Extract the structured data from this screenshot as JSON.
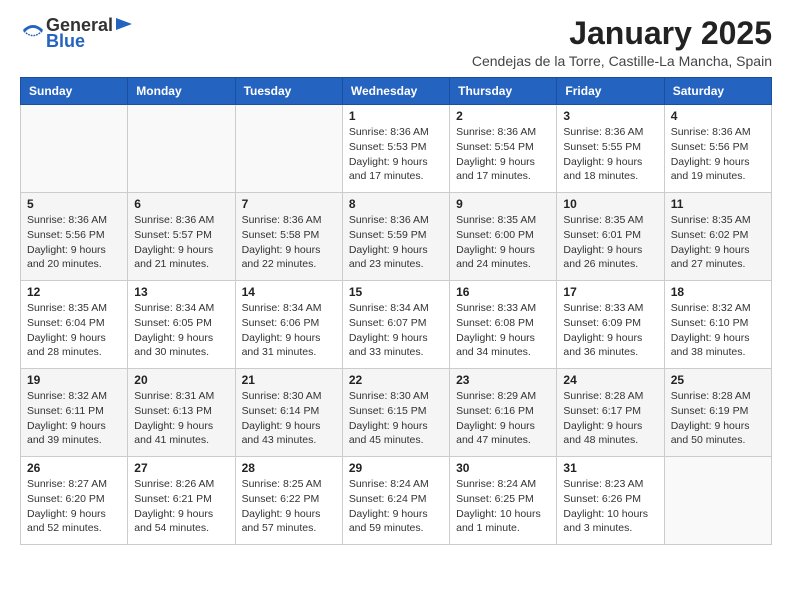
{
  "header": {
    "logo_general": "General",
    "logo_blue": "Blue",
    "month": "January 2025",
    "location": "Cendejas de la Torre, Castille-La Mancha, Spain"
  },
  "weekdays": [
    "Sunday",
    "Monday",
    "Tuesday",
    "Wednesday",
    "Thursday",
    "Friday",
    "Saturday"
  ],
  "weeks": [
    [
      {
        "day": "",
        "info": ""
      },
      {
        "day": "",
        "info": ""
      },
      {
        "day": "",
        "info": ""
      },
      {
        "day": "1",
        "info": "Sunrise: 8:36 AM\nSunset: 5:53 PM\nDaylight: 9 hours\nand 17 minutes."
      },
      {
        "day": "2",
        "info": "Sunrise: 8:36 AM\nSunset: 5:54 PM\nDaylight: 9 hours\nand 17 minutes."
      },
      {
        "day": "3",
        "info": "Sunrise: 8:36 AM\nSunset: 5:55 PM\nDaylight: 9 hours\nand 18 minutes."
      },
      {
        "day": "4",
        "info": "Sunrise: 8:36 AM\nSunset: 5:56 PM\nDaylight: 9 hours\nand 19 minutes."
      }
    ],
    [
      {
        "day": "5",
        "info": "Sunrise: 8:36 AM\nSunset: 5:56 PM\nDaylight: 9 hours\nand 20 minutes."
      },
      {
        "day": "6",
        "info": "Sunrise: 8:36 AM\nSunset: 5:57 PM\nDaylight: 9 hours\nand 21 minutes."
      },
      {
        "day": "7",
        "info": "Sunrise: 8:36 AM\nSunset: 5:58 PM\nDaylight: 9 hours\nand 22 minutes."
      },
      {
        "day": "8",
        "info": "Sunrise: 8:36 AM\nSunset: 5:59 PM\nDaylight: 9 hours\nand 23 minutes."
      },
      {
        "day": "9",
        "info": "Sunrise: 8:35 AM\nSunset: 6:00 PM\nDaylight: 9 hours\nand 24 minutes."
      },
      {
        "day": "10",
        "info": "Sunrise: 8:35 AM\nSunset: 6:01 PM\nDaylight: 9 hours\nand 26 minutes."
      },
      {
        "day": "11",
        "info": "Sunrise: 8:35 AM\nSunset: 6:02 PM\nDaylight: 9 hours\nand 27 minutes."
      }
    ],
    [
      {
        "day": "12",
        "info": "Sunrise: 8:35 AM\nSunset: 6:04 PM\nDaylight: 9 hours\nand 28 minutes."
      },
      {
        "day": "13",
        "info": "Sunrise: 8:34 AM\nSunset: 6:05 PM\nDaylight: 9 hours\nand 30 minutes."
      },
      {
        "day": "14",
        "info": "Sunrise: 8:34 AM\nSunset: 6:06 PM\nDaylight: 9 hours\nand 31 minutes."
      },
      {
        "day": "15",
        "info": "Sunrise: 8:34 AM\nSunset: 6:07 PM\nDaylight: 9 hours\nand 33 minutes."
      },
      {
        "day": "16",
        "info": "Sunrise: 8:33 AM\nSunset: 6:08 PM\nDaylight: 9 hours\nand 34 minutes."
      },
      {
        "day": "17",
        "info": "Sunrise: 8:33 AM\nSunset: 6:09 PM\nDaylight: 9 hours\nand 36 minutes."
      },
      {
        "day": "18",
        "info": "Sunrise: 8:32 AM\nSunset: 6:10 PM\nDaylight: 9 hours\nand 38 minutes."
      }
    ],
    [
      {
        "day": "19",
        "info": "Sunrise: 8:32 AM\nSunset: 6:11 PM\nDaylight: 9 hours\nand 39 minutes."
      },
      {
        "day": "20",
        "info": "Sunrise: 8:31 AM\nSunset: 6:13 PM\nDaylight: 9 hours\nand 41 minutes."
      },
      {
        "day": "21",
        "info": "Sunrise: 8:30 AM\nSunset: 6:14 PM\nDaylight: 9 hours\nand 43 minutes."
      },
      {
        "day": "22",
        "info": "Sunrise: 8:30 AM\nSunset: 6:15 PM\nDaylight: 9 hours\nand 45 minutes."
      },
      {
        "day": "23",
        "info": "Sunrise: 8:29 AM\nSunset: 6:16 PM\nDaylight: 9 hours\nand 47 minutes."
      },
      {
        "day": "24",
        "info": "Sunrise: 8:28 AM\nSunset: 6:17 PM\nDaylight: 9 hours\nand 48 minutes."
      },
      {
        "day": "25",
        "info": "Sunrise: 8:28 AM\nSunset: 6:19 PM\nDaylight: 9 hours\nand 50 minutes."
      }
    ],
    [
      {
        "day": "26",
        "info": "Sunrise: 8:27 AM\nSunset: 6:20 PM\nDaylight: 9 hours\nand 52 minutes."
      },
      {
        "day": "27",
        "info": "Sunrise: 8:26 AM\nSunset: 6:21 PM\nDaylight: 9 hours\nand 54 minutes."
      },
      {
        "day": "28",
        "info": "Sunrise: 8:25 AM\nSunset: 6:22 PM\nDaylight: 9 hours\nand 57 minutes."
      },
      {
        "day": "29",
        "info": "Sunrise: 8:24 AM\nSunset: 6:24 PM\nDaylight: 9 hours\nand 59 minutes."
      },
      {
        "day": "30",
        "info": "Sunrise: 8:24 AM\nSunset: 6:25 PM\nDaylight: 10 hours\nand 1 minute."
      },
      {
        "day": "31",
        "info": "Sunrise: 8:23 AM\nSunset: 6:26 PM\nDaylight: 10 hours\nand 3 minutes."
      },
      {
        "day": "",
        "info": ""
      }
    ]
  ]
}
